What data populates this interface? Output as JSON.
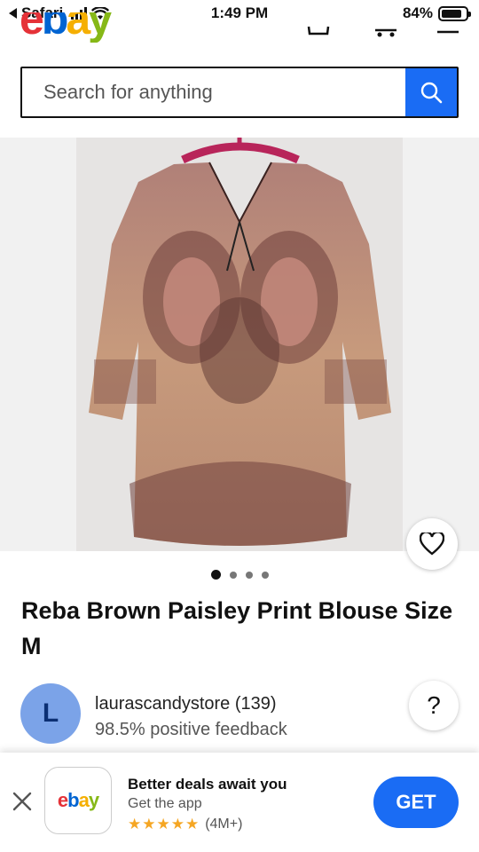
{
  "status_bar": {
    "back_app": "Safari",
    "time": "1:49 PM",
    "battery": "84%",
    "battery_level": 0.84
  },
  "header": {
    "logo_letters": [
      "e",
      "b",
      "a",
      "y"
    ],
    "logo_colors": [
      "#e53238",
      "#0064d2",
      "#f5af02",
      "#86b817"
    ],
    "icons": [
      "cart-icon",
      "account-icon",
      "menu-icon"
    ]
  },
  "search": {
    "placeholder": "Search for anything",
    "button_icon": "search-icon",
    "button_color": "#1a6cf4"
  },
  "gallery": {
    "image_alt": "Reba Brown Paisley Print Blouse",
    "image_count": 4,
    "active_index": 0,
    "favorite_icon": "heart-icon"
  },
  "product": {
    "title": "Reba Brown Paisley Print Blouse Size M"
  },
  "seller": {
    "avatar_letter": "L",
    "name": "laurascandystore (139)",
    "feedback": "98.5% positive feedback",
    "help_label": "?"
  },
  "app_banner": {
    "headline": "Better deals await you",
    "subline": "Get the app",
    "stars": "★★★★★",
    "rating_count": "(4M+)",
    "get_label": "GET",
    "app_logo_letters": [
      "e",
      "b",
      "a",
      "y"
    ]
  }
}
